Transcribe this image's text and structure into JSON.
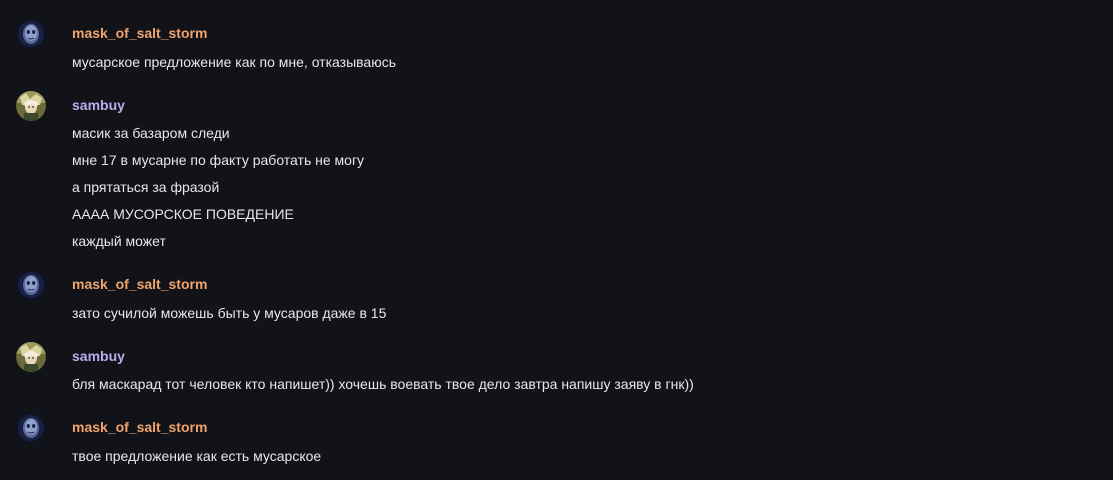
{
  "colors": {
    "background": "#111318",
    "text": "#e6e7ea",
    "user_salt": "#f0a46d",
    "user_sambuy": "#b7aef0"
  },
  "messages": [
    {
      "author": "mask_of_salt_storm",
      "avatar_icon": "masked-figure-avatar-icon",
      "color": "#f0a46d",
      "lines": [
        "мусарское предложение как по мне, отказываюсь"
      ]
    },
    {
      "author": "sambuy",
      "avatar_icon": "character-portrait-avatar-icon",
      "color": "#b7aef0",
      "lines": [
        "масик за базаром следи",
        "мне 17 в мусарне по факту работать не могу",
        "а прятаться за фразой",
        "АААА МУСОРСКОЕ ПОВЕДЕНИЕ",
        "каждый может"
      ]
    },
    {
      "author": "mask_of_salt_storm",
      "avatar_icon": "masked-figure-avatar-icon",
      "color": "#f0a46d",
      "lines": [
        "зато сучилой можешь быть у мусаров даже в 15"
      ]
    },
    {
      "author": "sambuy",
      "avatar_icon": "character-portrait-avatar-icon",
      "color": "#b7aef0",
      "lines": [
        "бля маскарад тот человек кто напишет)) хочешь воевать твое дело завтра напишу заяву в гнк))"
      ]
    },
    {
      "author": "mask_of_salt_storm",
      "avatar_icon": "masked-figure-avatar-icon",
      "color": "#f0a46d",
      "lines": [
        "твое предложение как есть мусарское"
      ]
    }
  ]
}
